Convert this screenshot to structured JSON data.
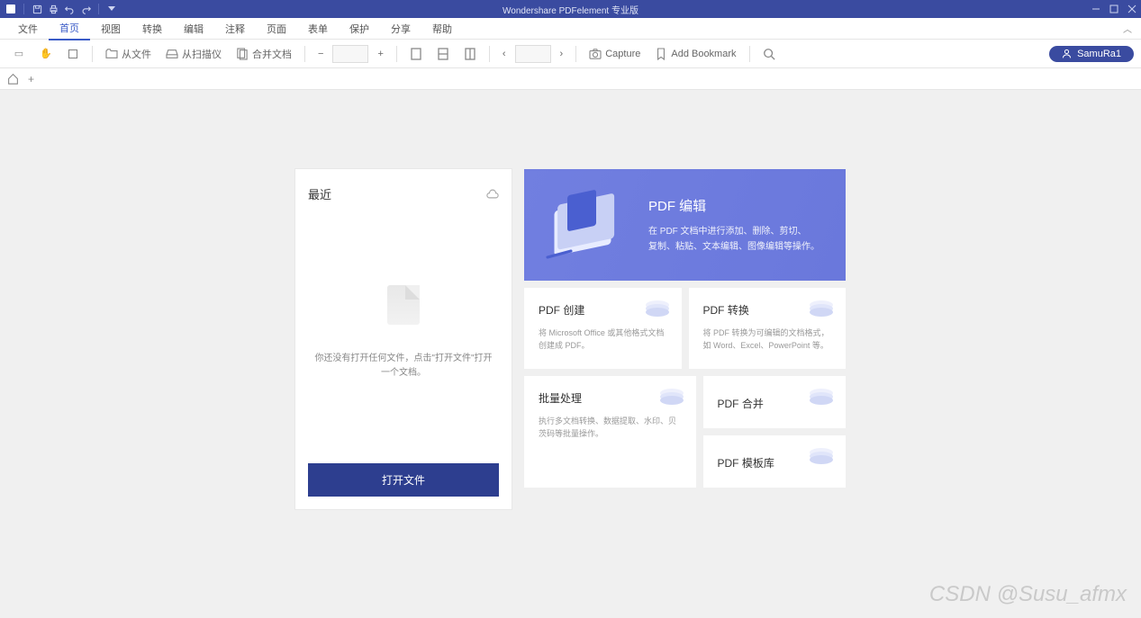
{
  "title": "Wondershare PDFelement 专业版",
  "menu": [
    "文件",
    "首页",
    "视图",
    "转换",
    "编辑",
    "注释",
    "页面",
    "表单",
    "保护",
    "分享",
    "帮助"
  ],
  "menu_active": 1,
  "toolbar": {
    "from_file": "从文件",
    "from_scanner": "从扫描仪",
    "merge": "合并文档",
    "capture": "Capture",
    "add_bookmark": "Add Bookmark"
  },
  "user": "SamuRa1",
  "recent": {
    "title": "最近",
    "empty_msg": "你还没有打开任何文件，点击\"打开文件\"打开一个文档。",
    "open_btn": "打开文件"
  },
  "hero": {
    "title": "PDF 编辑",
    "line1": "在 PDF 文档中进行添加、删除、剪切、",
    "line2": "复制、粘贴、文本编辑、图像编辑等操作。"
  },
  "cards": {
    "create": {
      "title": "PDF 创建",
      "desc": "将 Microsoft Office 或其他格式文档创建成 PDF。"
    },
    "convert": {
      "title": "PDF 转换",
      "desc": "将 PDF 转换为可编辑的文档格式，如 Word、Excel、PowerPoint 等。"
    },
    "batch": {
      "title": "批量处理",
      "desc": "执行多文档转换、数据提取、水印、贝茨码等批量操作。"
    },
    "merge": {
      "title": "PDF 合并"
    },
    "template": {
      "title": "PDF 模板库"
    }
  },
  "watermark": "CSDN @Susu_afmx"
}
